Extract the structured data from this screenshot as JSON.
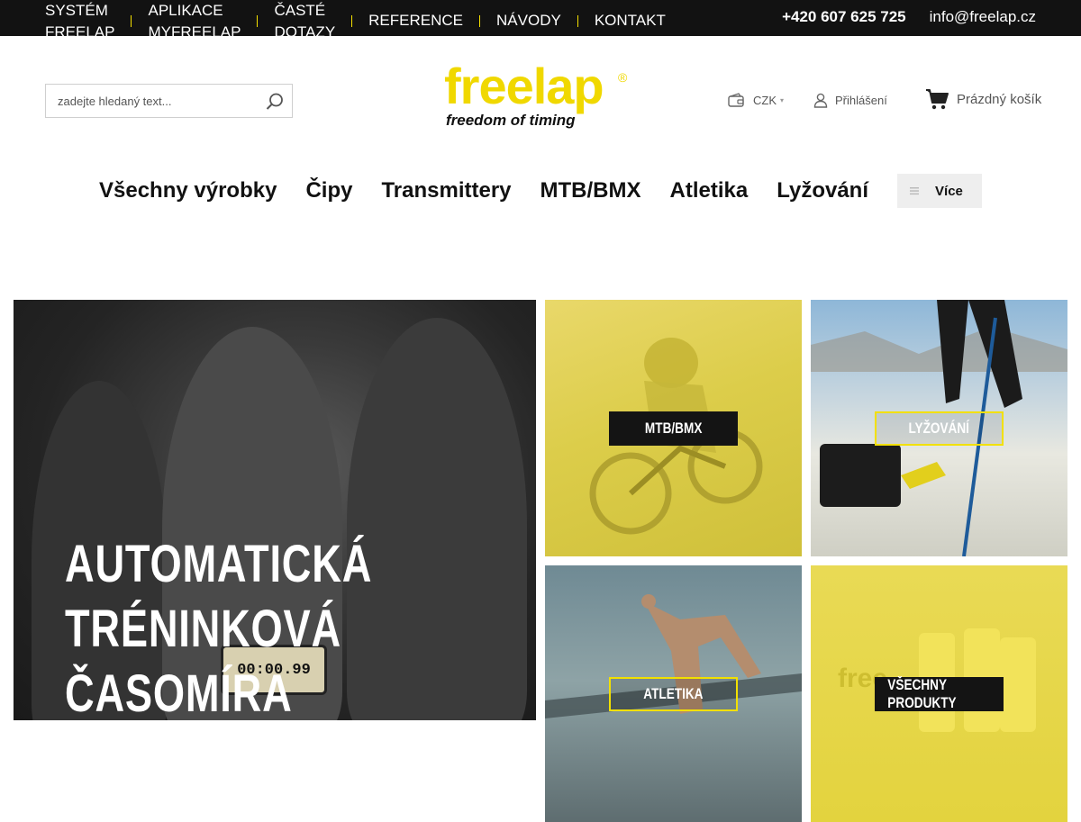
{
  "topbar": {
    "nav": [
      {
        "line1": "SYSTÉM",
        "line2": "FREELAP"
      },
      {
        "line1": "APLIKACE",
        "line2": "MYFREELAP"
      },
      {
        "line1": "ČASTÉ",
        "line2": "DOTAZY"
      },
      {
        "line1": "REFERENCE",
        "line2": ""
      },
      {
        "line1": "NÁVODY",
        "line2": ""
      },
      {
        "line1": "KONTAKT",
        "line2": ""
      }
    ],
    "phone": "+420 607 625 725",
    "email": "info@freelap.cz",
    "separator_color": "#f5e000"
  },
  "header": {
    "search_placeholder": "zadejte hledaný text...",
    "logo_word": "freelap",
    "logo_reg": "®",
    "logo_tagline": "freedom of timing",
    "currency": "CZK",
    "login_label": "Přihlášení",
    "cart_label": "Prázdný košík",
    "brand_color": "#f0d800"
  },
  "mainnav": {
    "items": [
      "Všechny výrobky",
      "Čipy",
      "Transmittery",
      "MTB/BMX",
      "Atletika",
      "Lyžování"
    ],
    "more_label": "Více"
  },
  "banners": {
    "hero": {
      "lines": [
        "AUTOMATICKÁ",
        "TRÉNINKOVÁ",
        "ČASOMÍRA"
      ],
      "watch_display": "00:00.99"
    },
    "tiles": [
      {
        "label": "MTB/BMX"
      },
      {
        "label": "LYŽOVÁNÍ"
      },
      {
        "label": "ATLETIKA"
      },
      {
        "label": "VŠECHNY PRODUKTY"
      }
    ]
  }
}
